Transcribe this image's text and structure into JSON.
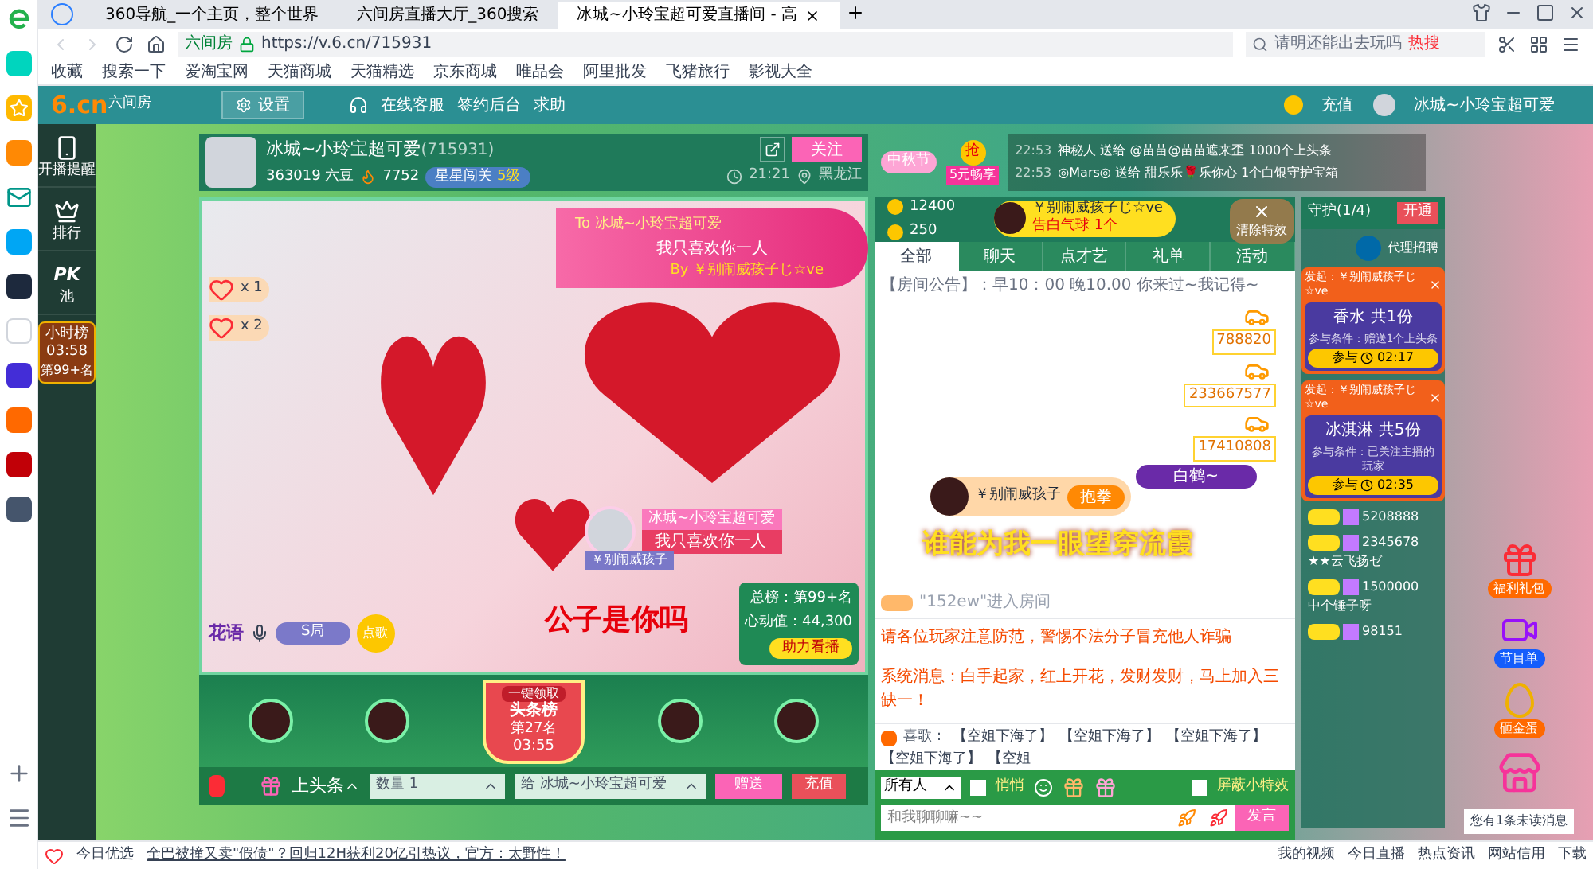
{
  "browser": {
    "tabs": [
      {
        "label": "360导航_一个主页，整个世界",
        "selected": false
      },
      {
        "label": "六间房直播大厅_360搜索",
        "selected": false
      },
      {
        "label": "冰城~小玲宝超可爱直播间 - 高",
        "selected": true
      }
    ],
    "address": {
      "site": "六间房",
      "url": "https://v.6.cn/715931"
    },
    "search": {
      "value": "请明还能出去玩吗",
      "hot": "热搜"
    },
    "bookmarks": [
      "收藏",
      "搜索一下",
      "爱淘宝网",
      "天猫商城",
      "天猫精选",
      "京东商城",
      "唯品会",
      "阿里批发",
      "飞猪旅行",
      "影视大全"
    ]
  },
  "site_nav": {
    "logo": "6.cn",
    "logo_sub": "六间房",
    "settings": "设置",
    "links": [
      "在线客服",
      "签约后台",
      "求助"
    ],
    "recharge": "充值",
    "user": "冰城~小玲宝超可爱"
  },
  "side_menu": [
    {
      "label": "开播提醒",
      "kind": "phone"
    },
    {
      "label": "排行",
      "kind": "crown"
    },
    {
      "label": "池",
      "kind": "pk",
      "title": "PK"
    }
  ],
  "hour_rank": {
    "title": "小时榜",
    "time": "03:58",
    "rank": "第99+名"
  },
  "anchor": {
    "name": "冰城~小玲宝超可爱",
    "id": "(715931)",
    "beans": "363019 六豆",
    "fire": "7752",
    "badge": "星星闯关",
    "badge_level": "5级",
    "follow": "关注",
    "time": "21:21",
    "place": "黑龙江"
  },
  "promos": {
    "festival": "中秋节",
    "grab": "抢",
    "grab_label": "5元畅享"
  },
  "feed": [
    {
      "time": "22:53",
      "text": "神秘人 送给 @苗苗@苗苗遮来歪 1000个上头条"
    },
    {
      "time": "22:53",
      "text": "◎Mars◎ 送给 甜乐乐🌹乐你心 1个白银守护宝箱"
    }
  ],
  "video": {
    "gift_banner": {
      "to": "To 冰城~小玲宝超可爱",
      "message": "我只喜欢你一人",
      "by": "By ￥别闹威孩子じ☆ve"
    },
    "combos": [
      "x 1",
      "x 2"
    ],
    "bubble": {
      "name": "冰城~小玲宝超可爱",
      "message": "我只喜欢你一人",
      "sender": "￥别闹威孩子"
    },
    "caption": "公子是你吗",
    "song": {
      "label": "花语",
      "name": "S局",
      "button": "点歌"
    },
    "rank_card": {
      "total": "总榜：第99+名",
      "heart": "心动值：44,300",
      "button": "助力看播"
    }
  },
  "gift_strip": {
    "badge": "一键领取",
    "title": "头条榜",
    "rank": "第27名",
    "time": "03:55"
  },
  "send_bar": {
    "headline": "上头条",
    "quantity": "数量 1",
    "target": "给 冰城~小玲宝超可爱",
    "send": "赠送",
    "recharge": "充值"
  },
  "chat": {
    "stats": [
      "12400",
      "250"
    ],
    "tabs": [
      {
        "label": "全部",
        "selected": true
      },
      {
        "label": "聊天",
        "selected": false
      },
      {
        "label": "点才艺",
        "selected": false
      },
      {
        "label": "礼单",
        "selected": false
      },
      {
        "label": "活动",
        "selected": false
      }
    ],
    "messages": [
      {
        "kind": "notice",
        "text": "【房间公告】：早10：00 晚10.00 你来过~我记得~"
      },
      {
        "kind": "car",
        "text": "788820"
      },
      {
        "kind": "car",
        "text": "233667577"
      },
      {
        "kind": "car",
        "text": "17410808"
      },
      {
        "kind": "tag",
        "text": "白鹤~"
      },
      {
        "kind": "enter",
        "text": "\"152ew\"进入房间"
      },
      {
        "kind": "warning",
        "text": "请各位玩家注意防范，警惕不法分子冒充他人诈骗"
      },
      {
        "kind": "system",
        "text": "系统消息：白手起家，红上开花，发财发财，马上加入三缺一！"
      }
    ],
    "marquee": {
      "label": "喜歌：",
      "items": [
        "【空姐下海了】",
        "【空姐下海了】",
        "【空姐下海了】",
        "【空姐下海了】",
        "【空姐"
      ]
    },
    "audience": "所有人",
    "whisper": {
      "label": "悄悄",
      "checked": false
    },
    "block": {
      "label": "屏蔽小特效",
      "checked": false
    },
    "placeholder": "和我聊聊嘛~~",
    "send": "发言"
  },
  "guard": {
    "title": "守护(1/4)",
    "open": "开通",
    "caption": "代理招聘"
  },
  "lotteries": [
    {
      "sender": "发起：￥别闹威孩子じ☆ve",
      "prize": "香水 共1份",
      "rule": "参与条件：赠送1个上头条",
      "join": "参与",
      "time": "02:17"
    },
    {
      "sender": "发起：￥别闹威孩子じ☆ve",
      "prize": "冰淇淋 共5份",
      "rule": "参与条件：已关注主播的玩家",
      "join": "参与",
      "time": "02:35"
    }
  ],
  "users": [
    {
      "id": "5208888"
    },
    {
      "id": "2345678",
      "name": "★★云飞扬ゼ"
    },
    {
      "id": "1500000",
      "name": "中个锤子呀"
    },
    {
      "id": "98151"
    }
  ],
  "side_buttons": [
    "福利礼包",
    "节目单",
    "砸金蛋"
  ],
  "unread": "您有1条未读消息",
  "effects": {
    "clear": "清除特效",
    "balloon_sender": "￥别闹威孩子じ☆ve",
    "balloon_gift": "告白气球 1个",
    "salute_sender": "￥别闹威孩子",
    "salute": "抱拳",
    "banner": "谁能为我一眼望穿流霞"
  },
  "status_bar": {
    "label": "今日优选",
    "news": "全巴被撞又卖\"假债\"？回归12H获利20亿引热议，官方：太野性！",
    "links": [
      "我的视频",
      "今日直播",
      "热点资讯",
      "网站信用",
      "下载"
    ]
  }
}
